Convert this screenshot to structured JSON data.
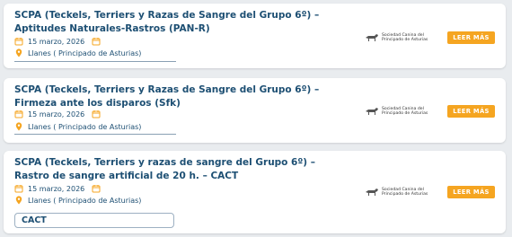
{
  "events": [
    {
      "title": "SCPA (Teckels, Terriers y Razas de Sangre del Grupo 6º) – Aptitudes Naturales-Rastros (PAN-R)",
      "date": "15 marzo, 2026",
      "location": "Llanes ( Principado de Asturias)",
      "org_line1": "Sociedad Canina del",
      "org_line2": "Principado de Asturias",
      "button": "LEER MÁS",
      "tag": ""
    },
    {
      "title": "SCPA (Teckels, Terriers y Razas de Sangre del Grupo 6º) – Firmeza ante los disparos (Sfk)",
      "date": "15 marzo, 2026",
      "location": "Llanes ( Principado de Asturias)",
      "org_line1": "Sociedad Canina del",
      "org_line2": "Principado de Asturias",
      "button": "LEER MÁS",
      "tag": ""
    },
    {
      "title": "SCPA (Teckels, Terriers y razas de sangre del Grupo 6º) – Rastro de sangre artificial de 20 h. – CACT",
      "date": "15 marzo, 2026",
      "location": "Llanes ( Principado de Asturias)",
      "org_line1": "Sociedad Canina del",
      "org_line2": "Principado de Asturias",
      "button": "LEER MÁS",
      "tag": "CACT"
    }
  ],
  "colors": {
    "title": "#1d4f73",
    "accent": "#f5a521",
    "background": "#e9ecef"
  },
  "icons": {
    "date": "calendar-icon",
    "location": "map-pin-icon",
    "org": "dog-logo-icon"
  }
}
